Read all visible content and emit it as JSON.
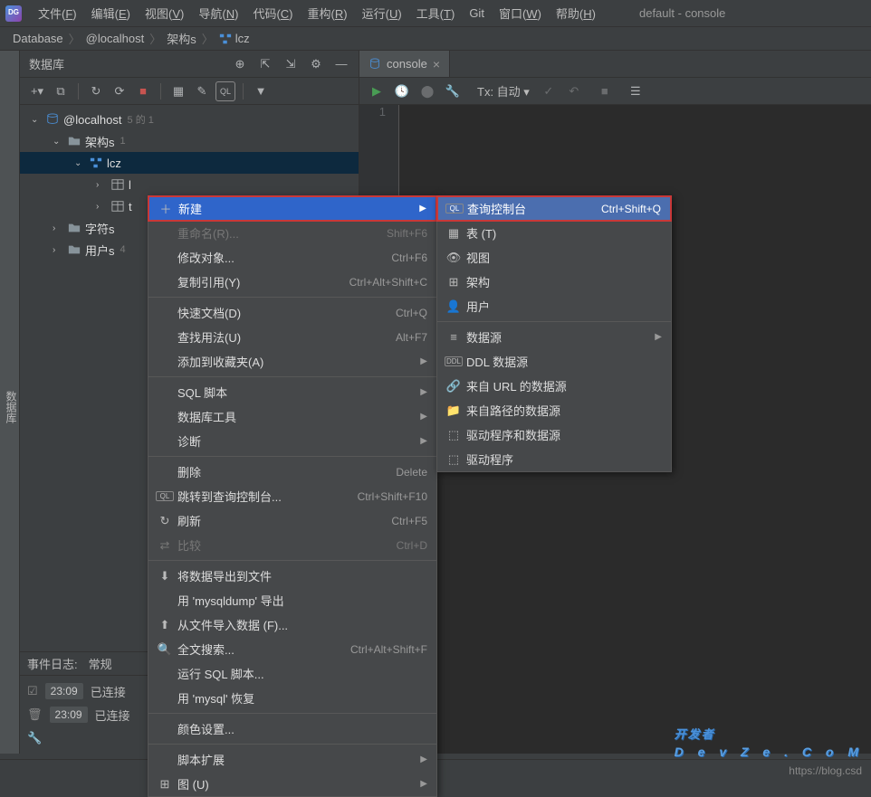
{
  "window_title": "default - console",
  "menubar": [
    {
      "label": "文件(F)",
      "key": "F"
    },
    {
      "label": "编辑(E)",
      "key": "E"
    },
    {
      "label": "视图(V)",
      "key": "V"
    },
    {
      "label": "导航(N)",
      "key": "N"
    },
    {
      "label": "代码(C)",
      "key": "C"
    },
    {
      "label": "重构(R)",
      "key": "R"
    },
    {
      "label": "运行(U)",
      "key": "U"
    },
    {
      "label": "工具(T)",
      "key": "T"
    },
    {
      "label": "Git",
      "key": ""
    },
    {
      "label": "窗口(W)",
      "key": "W"
    },
    {
      "label": "帮助(H)",
      "key": "H"
    }
  ],
  "breadcrumb": [
    {
      "label": "Database"
    },
    {
      "label": "@localhost"
    },
    {
      "label": "架构s"
    },
    {
      "label": "lcz"
    }
  ],
  "sidebar_tab": "数据库",
  "db_panel": {
    "title": "数据库",
    "tree": {
      "root": {
        "label": "@localhost",
        "count": "5 的 1",
        "expanded": true
      },
      "schemas": {
        "label": "架构s",
        "count": "1",
        "expanded": true
      },
      "lcz": {
        "label": "lcz",
        "expanded": true
      },
      "lcz_children": [
        {
          "label": "l",
          "type": "table"
        },
        {
          "label": "t",
          "type": "table"
        }
      ],
      "charsets": {
        "label": "字符s",
        "count": ""
      },
      "users": {
        "label": "用户s",
        "count": "4"
      }
    }
  },
  "editor": {
    "tab_label": "console",
    "tx_label": "Tx: 自动",
    "line_number": "1"
  },
  "context_menu": [
    {
      "icon": "plus",
      "label": "新建",
      "shortcut": "",
      "highlighted": true,
      "submenu": true
    },
    {
      "icon": "",
      "label": "重命名(R)...",
      "shortcut": "Shift+F6",
      "disabled": true
    },
    {
      "icon": "",
      "label": "修改对象...",
      "shortcut": "Ctrl+F6"
    },
    {
      "icon": "",
      "label": "复制引用(Y)",
      "shortcut": "Ctrl+Alt+Shift+C"
    },
    {
      "divider": true
    },
    {
      "icon": "",
      "label": "快速文档(D)",
      "shortcut": "Ctrl+Q"
    },
    {
      "icon": "",
      "label": "查找用法(U)",
      "shortcut": "Alt+F7"
    },
    {
      "icon": "",
      "label": "添加到收藏夹(A)",
      "shortcut": "",
      "submenu": true
    },
    {
      "divider": true
    },
    {
      "icon": "",
      "label": "SQL 脚本",
      "shortcut": "",
      "submenu": true
    },
    {
      "icon": "",
      "label": "数据库工具",
      "shortcut": "",
      "submenu": true
    },
    {
      "icon": "",
      "label": "诊断",
      "shortcut": "",
      "submenu": true
    },
    {
      "divider": true
    },
    {
      "icon": "",
      "label": "删除",
      "shortcut": "Delete"
    },
    {
      "icon": "ql",
      "label": "跳转到查询控制台...",
      "shortcut": "Ctrl+Shift+F10"
    },
    {
      "icon": "refresh",
      "label": "刷新",
      "shortcut": "Ctrl+F5"
    },
    {
      "icon": "compare",
      "label": "比较",
      "shortcut": "Ctrl+D",
      "disabled": true
    },
    {
      "divider": true
    },
    {
      "icon": "export",
      "label": "将数据导出到文件"
    },
    {
      "icon": "",
      "label": "用 'mysqldump' 导出"
    },
    {
      "icon": "import",
      "label": "从文件导入数据 (F)..."
    },
    {
      "icon": "search",
      "label": "全文搜索...",
      "shortcut": "Ctrl+Alt+Shift+F"
    },
    {
      "icon": "",
      "label": "运行 SQL 脚本..."
    },
    {
      "icon": "",
      "label": "用 'mysql' 恢复"
    },
    {
      "divider": true
    },
    {
      "icon": "",
      "label": "颜色设置..."
    },
    {
      "divider": true
    },
    {
      "icon": "",
      "label": "脚本扩展",
      "submenu": true
    },
    {
      "icon": "diagram",
      "label": "图 (U)",
      "submenu": true
    }
  ],
  "submenu": [
    {
      "icon": "ql",
      "label": "查询控制台",
      "shortcut": "Ctrl+Shift+Q",
      "highlighted": true
    },
    {
      "icon": "table",
      "label": "表 (T)"
    },
    {
      "icon": "view",
      "label": "视图"
    },
    {
      "icon": "schema",
      "label": "架构"
    },
    {
      "icon": "user",
      "label": "用户"
    },
    {
      "divider": true
    },
    {
      "icon": "datasource",
      "label": "数据源",
      "submenu": true
    },
    {
      "icon": "ddl",
      "label": "DDL 数据源"
    },
    {
      "icon": "url",
      "label": "来自 URL 的数据源"
    },
    {
      "icon": "folder",
      "label": "来自路径的数据源"
    },
    {
      "icon": "driver",
      "label": "驱动程序和数据源"
    },
    {
      "icon": "driver",
      "label": "驱动程序"
    }
  ],
  "event_log": {
    "title": "事件日志:",
    "tab": "常规",
    "rows": [
      {
        "time": "23:09",
        "text": "已连接"
      },
      {
        "time": "23:09",
        "text": "已连接"
      }
    ]
  },
  "status_url": "https://blog.csd",
  "watermark": {
    "main": "开发者",
    "sub": "D e v Z e . C o M"
  }
}
